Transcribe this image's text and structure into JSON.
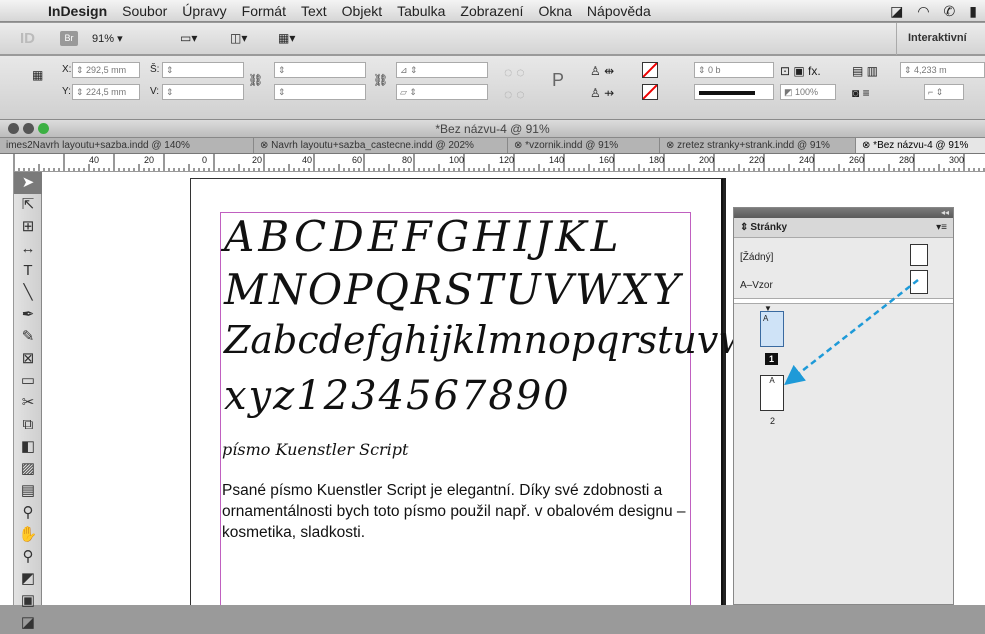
{
  "menubar": {
    "app": "InDesign",
    "items": [
      "Soubor",
      "Úpravy",
      "Formát",
      "Text",
      "Objekt",
      "Tabulka",
      "Zobrazení",
      "Okna",
      "Nápověda"
    ]
  },
  "appbar": {
    "logo": "ID",
    "bridge": "Br",
    "zoom": "91%",
    "workspace": "Interaktivní"
  },
  "control": {
    "x_label": "X:",
    "x_value": "292,5 mm",
    "y_label": "Y:",
    "y_value": "224,5 mm",
    "w_label": "Š:",
    "h_label": "V:",
    "stroke_weight": "0 b",
    "scale": "100%",
    "measure": "4,233 m"
  },
  "window": {
    "title": "*Bez názvu-4 @ 91%"
  },
  "tabs": [
    "imes2Navrh layoutu+sazba.indd @ 140%",
    "Navrh layoutu+sazba_castecne.indd @ 202%",
    "*vzornik.indd @ 91%",
    "zretez stranky+strank.indd @ 91%",
    "*Bez názvu-4 @ 91%"
  ],
  "ruler": {
    "ticks": [
      "40",
      "20",
      "0",
      "20",
      "40",
      "60",
      "80",
      "100",
      "120",
      "140",
      "160",
      "180",
      "200",
      "220",
      "240",
      "260",
      "280",
      "300"
    ]
  },
  "document": {
    "line1": "ABCDEFGHIJKL",
    "line2": "MNOPQRSTUVWXY",
    "line3": "Zabcdefghijklmnopqrstuvw",
    "line4": "xyz1234567890",
    "caption": "písmo Kuenstler Script",
    "paragraph": "Psané písmo Kuenstler Script je elegantní. Díky své zdobnosti a ornamentálnosti bych toto písmo použil např. v obalovém designu – kosmetika, sladkosti."
  },
  "pages_panel": {
    "title": "Stránky",
    "none_master": "[Žádný]",
    "a_master": "A–Vzor",
    "page1_number": "1",
    "page2_label": "A",
    "page2_number": "2",
    "page1_label": "A"
  },
  "colors": {
    "accent": "#1e9ad8",
    "margin": "#c060c0"
  }
}
